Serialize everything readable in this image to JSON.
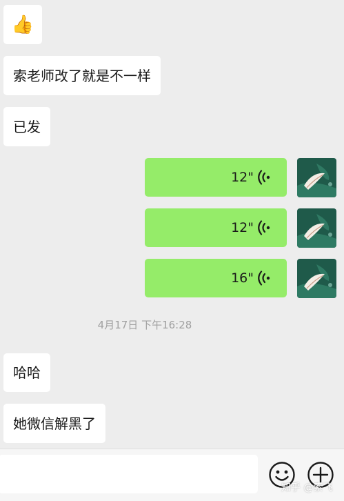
{
  "messages_in": [
    {
      "text": "👍"
    },
    {
      "text": "索老师改了就是不一样"
    },
    {
      "text": "已发"
    }
  ],
  "voice_messages": [
    {
      "duration": "12\""
    },
    {
      "duration": "12\""
    },
    {
      "duration": "16\""
    }
  ],
  "timestamp": "4月17日 下午16:28",
  "messages_in_after": [
    {
      "text": "哈哈"
    },
    {
      "text": "她微信解黑了"
    }
  ],
  "input_bar": {
    "value": "",
    "placeholder": ""
  },
  "watermark": "知乎 @索飞",
  "colors": {
    "background": "#ededed",
    "incoming_bubble": "#ffffff",
    "outgoing_bubble": "#95ec69",
    "timestamp_text": "#a0a0a0"
  },
  "icons": [
    "thumbs-up-emoji",
    "voice-wave-icon",
    "emoji-icon",
    "plus-icon",
    "avatar-image"
  ]
}
